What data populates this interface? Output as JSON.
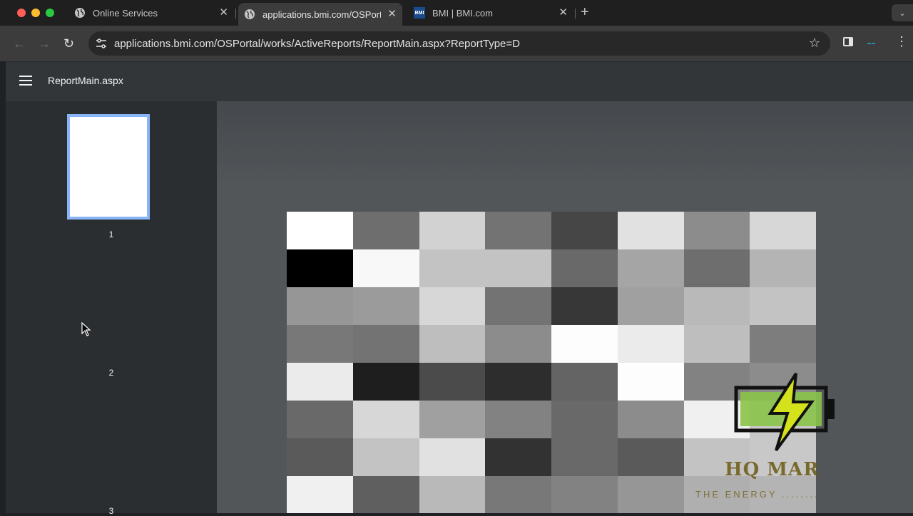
{
  "browser": {
    "tabs": [
      {
        "title": "Online Services",
        "active": false
      },
      {
        "title": "applications.bmi.com/OSPort",
        "active": true
      },
      {
        "title": "BMI | BMI.com",
        "active": false
      }
    ],
    "url": "applications.bmi.com/OSPortal/works/ActiveReports/ReportMain.aspx?ReportType=D"
  },
  "viewer": {
    "title": "ReportMain.aspx",
    "pages": [
      "1",
      "2",
      "3"
    ]
  },
  "watermark": {
    "brand": "HQ MAR",
    "tagline": "THE ENERGY ........"
  },
  "colors": {
    "accent_thumbnail_border": "#8ab4f8",
    "viewer_bg": "#525659",
    "sidebar_bg": "#2b2e31"
  },
  "redacted_grid": [
    [
      255,
      110,
      210,
      115,
      70,
      225,
      140,
      215
    ],
    [
      0,
      248,
      195,
      195,
      105,
      165,
      110,
      180
    ],
    [
      150,
      155,
      215,
      115,
      55,
      160,
      185,
      195
    ],
    [
      120,
      115,
      190,
      140,
      253,
      235,
      190,
      125
    ],
    [
      235,
      30,
      75,
      45,
      100,
      253,
      130,
      140
    ],
    [
      105,
      215,
      160,
      130,
      105,
      140,
      240,
      200
    ],
    [
      90,
      195,
      225,
      50,
      105,
      90,
      195,
      200
    ],
    [
      240,
      95,
      185,
      120,
      130,
      150,
      175,
      180
    ]
  ]
}
